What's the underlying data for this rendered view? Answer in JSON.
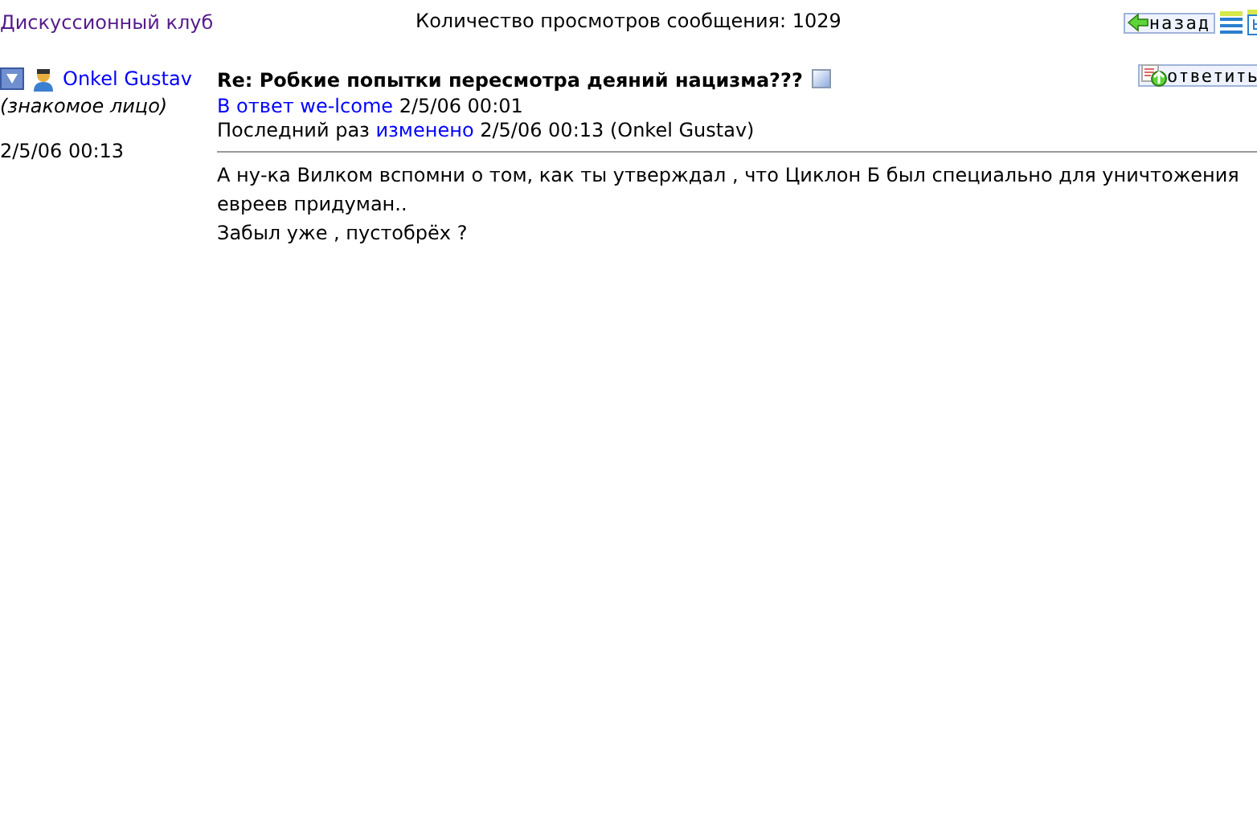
{
  "header": {
    "forum_link": "Дискуссионный клуб",
    "views": "Количество просмотров сообщения: 1029",
    "back_button": "назад"
  },
  "post": {
    "author": "Onkel Gustav",
    "author_status": "(знакомое лицо)",
    "posted": "2/5/06 00:13",
    "title": "Re: Робкие попытки пересмотра деяний нацизма???",
    "reply_button": "ответить",
    "reply_to_label": "В ответ",
    "reply_to_user": "we-lcome",
    "reply_to_time": "2/5/06 00:01",
    "edited_label": "Последний раз",
    "edited_link": "изменено",
    "edited_info": "2/5/06 00:13 (Onkel Gustav)",
    "body": [
      "А ну-ка Вилком вспомни о том, как ты утверждал , что Циклон Б был специально для уничтожения евреев придуман..",
      "Забыл уже , пустобрёх ?"
    ]
  }
}
